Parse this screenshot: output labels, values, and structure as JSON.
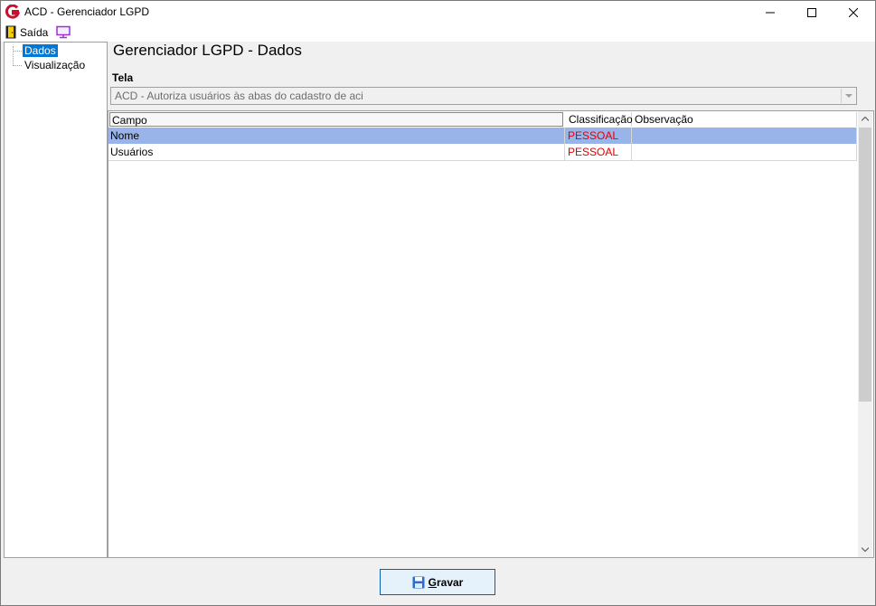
{
  "window": {
    "title": "ACD - Gerenciador LGPD",
    "app_icon": "app-logo-icon",
    "controls": [
      "minimize-icon",
      "maximize-icon",
      "close-icon"
    ]
  },
  "toolbar": {
    "exit_label": "Saída",
    "exit_icon": "exit-door-icon",
    "monitor_icon": "monitor-icon"
  },
  "tree": {
    "items": [
      {
        "label": "Dados",
        "selected": true
      },
      {
        "label": "Visualização",
        "selected": false
      }
    ]
  },
  "main": {
    "title": "Gerenciador LGPD - Dados",
    "tela_label": "Tela",
    "tela_value": "ACD - Autoriza usuários às abas do cadastro de aci"
  },
  "grid": {
    "columns": [
      "Campo",
      "Classificação",
      "Observação"
    ],
    "rows": [
      {
        "campo": "Nome",
        "classificacao": "PESSOAL",
        "observacao": "",
        "selected": true
      },
      {
        "campo": "Usuários",
        "classificacao": "PESSOAL",
        "observacao": "",
        "selected": false
      }
    ]
  },
  "footer": {
    "save_label_first": "G",
    "save_label_rest": "ravar",
    "save_icon": "floppy-disk-icon"
  },
  "colors": {
    "selection": "#0078d7",
    "row_highlight": "#99b4e8",
    "classification_text": "#e00000"
  }
}
